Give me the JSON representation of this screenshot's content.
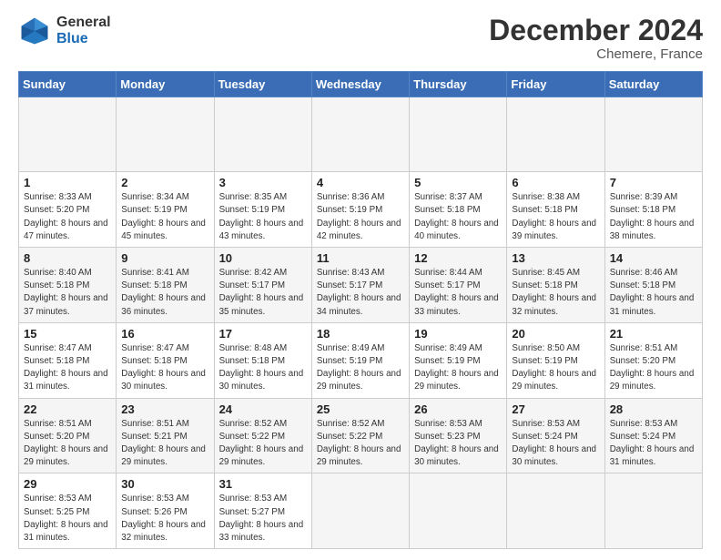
{
  "header": {
    "logo": {
      "general": "General",
      "blue": "Blue"
    },
    "month_title": "December 2024",
    "location": "Chemere, France"
  },
  "calendar": {
    "days_of_week": [
      "Sunday",
      "Monday",
      "Tuesday",
      "Wednesday",
      "Thursday",
      "Friday",
      "Saturday"
    ],
    "weeks": [
      [
        {
          "day": null,
          "info": null
        },
        {
          "day": null,
          "info": null
        },
        {
          "day": null,
          "info": null
        },
        {
          "day": null,
          "info": null
        },
        {
          "day": null,
          "info": null
        },
        {
          "day": null,
          "info": null
        },
        {
          "day": null,
          "info": null
        }
      ],
      [
        {
          "day": "1",
          "sunrise": "Sunrise: 8:33 AM",
          "sunset": "Sunset: 5:20 PM",
          "daylight": "Daylight: 8 hours and 47 minutes."
        },
        {
          "day": "2",
          "sunrise": "Sunrise: 8:34 AM",
          "sunset": "Sunset: 5:19 PM",
          "daylight": "Daylight: 8 hours and 45 minutes."
        },
        {
          "day": "3",
          "sunrise": "Sunrise: 8:35 AM",
          "sunset": "Sunset: 5:19 PM",
          "daylight": "Daylight: 8 hours and 43 minutes."
        },
        {
          "day": "4",
          "sunrise": "Sunrise: 8:36 AM",
          "sunset": "Sunset: 5:19 PM",
          "daylight": "Daylight: 8 hours and 42 minutes."
        },
        {
          "day": "5",
          "sunrise": "Sunrise: 8:37 AM",
          "sunset": "Sunset: 5:18 PM",
          "daylight": "Daylight: 8 hours and 40 minutes."
        },
        {
          "day": "6",
          "sunrise": "Sunrise: 8:38 AM",
          "sunset": "Sunset: 5:18 PM",
          "daylight": "Daylight: 8 hours and 39 minutes."
        },
        {
          "day": "7",
          "sunrise": "Sunrise: 8:39 AM",
          "sunset": "Sunset: 5:18 PM",
          "daylight": "Daylight: 8 hours and 38 minutes."
        }
      ],
      [
        {
          "day": "8",
          "sunrise": "Sunrise: 8:40 AM",
          "sunset": "Sunset: 5:18 PM",
          "daylight": "Daylight: 8 hours and 37 minutes."
        },
        {
          "day": "9",
          "sunrise": "Sunrise: 8:41 AM",
          "sunset": "Sunset: 5:18 PM",
          "daylight": "Daylight: 8 hours and 36 minutes."
        },
        {
          "day": "10",
          "sunrise": "Sunrise: 8:42 AM",
          "sunset": "Sunset: 5:17 PM",
          "daylight": "Daylight: 8 hours and 35 minutes."
        },
        {
          "day": "11",
          "sunrise": "Sunrise: 8:43 AM",
          "sunset": "Sunset: 5:17 PM",
          "daylight": "Daylight: 8 hours and 34 minutes."
        },
        {
          "day": "12",
          "sunrise": "Sunrise: 8:44 AM",
          "sunset": "Sunset: 5:17 PM",
          "daylight": "Daylight: 8 hours and 33 minutes."
        },
        {
          "day": "13",
          "sunrise": "Sunrise: 8:45 AM",
          "sunset": "Sunset: 5:18 PM",
          "daylight": "Daylight: 8 hours and 32 minutes."
        },
        {
          "day": "14",
          "sunrise": "Sunrise: 8:46 AM",
          "sunset": "Sunset: 5:18 PM",
          "daylight": "Daylight: 8 hours and 31 minutes."
        }
      ],
      [
        {
          "day": "15",
          "sunrise": "Sunrise: 8:47 AM",
          "sunset": "Sunset: 5:18 PM",
          "daylight": "Daylight: 8 hours and 31 minutes."
        },
        {
          "day": "16",
          "sunrise": "Sunrise: 8:47 AM",
          "sunset": "Sunset: 5:18 PM",
          "daylight": "Daylight: 8 hours and 30 minutes."
        },
        {
          "day": "17",
          "sunrise": "Sunrise: 8:48 AM",
          "sunset": "Sunset: 5:18 PM",
          "daylight": "Daylight: 8 hours and 30 minutes."
        },
        {
          "day": "18",
          "sunrise": "Sunrise: 8:49 AM",
          "sunset": "Sunset: 5:19 PM",
          "daylight": "Daylight: 8 hours and 29 minutes."
        },
        {
          "day": "19",
          "sunrise": "Sunrise: 8:49 AM",
          "sunset": "Sunset: 5:19 PM",
          "daylight": "Daylight: 8 hours and 29 minutes."
        },
        {
          "day": "20",
          "sunrise": "Sunrise: 8:50 AM",
          "sunset": "Sunset: 5:19 PM",
          "daylight": "Daylight: 8 hours and 29 minutes."
        },
        {
          "day": "21",
          "sunrise": "Sunrise: 8:51 AM",
          "sunset": "Sunset: 5:20 PM",
          "daylight": "Daylight: 8 hours and 29 minutes."
        }
      ],
      [
        {
          "day": "22",
          "sunrise": "Sunrise: 8:51 AM",
          "sunset": "Sunset: 5:20 PM",
          "daylight": "Daylight: 8 hours and 29 minutes."
        },
        {
          "day": "23",
          "sunrise": "Sunrise: 8:51 AM",
          "sunset": "Sunset: 5:21 PM",
          "daylight": "Daylight: 8 hours and 29 minutes."
        },
        {
          "day": "24",
          "sunrise": "Sunrise: 8:52 AM",
          "sunset": "Sunset: 5:22 PM",
          "daylight": "Daylight: 8 hours and 29 minutes."
        },
        {
          "day": "25",
          "sunrise": "Sunrise: 8:52 AM",
          "sunset": "Sunset: 5:22 PM",
          "daylight": "Daylight: 8 hours and 29 minutes."
        },
        {
          "day": "26",
          "sunrise": "Sunrise: 8:53 AM",
          "sunset": "Sunset: 5:23 PM",
          "daylight": "Daylight: 8 hours and 30 minutes."
        },
        {
          "day": "27",
          "sunrise": "Sunrise: 8:53 AM",
          "sunset": "Sunset: 5:24 PM",
          "daylight": "Daylight: 8 hours and 30 minutes."
        },
        {
          "day": "28",
          "sunrise": "Sunrise: 8:53 AM",
          "sunset": "Sunset: 5:24 PM",
          "daylight": "Daylight: 8 hours and 31 minutes."
        }
      ],
      [
        {
          "day": "29",
          "sunrise": "Sunrise: 8:53 AM",
          "sunset": "Sunset: 5:25 PM",
          "daylight": "Daylight: 8 hours and 31 minutes."
        },
        {
          "day": "30",
          "sunrise": "Sunrise: 8:53 AM",
          "sunset": "Sunset: 5:26 PM",
          "daylight": "Daylight: 8 hours and 32 minutes."
        },
        {
          "day": "31",
          "sunrise": "Sunrise: 8:53 AM",
          "sunset": "Sunset: 5:27 PM",
          "daylight": "Daylight: 8 hours and 33 minutes."
        },
        {
          "day": null,
          "info": null
        },
        {
          "day": null,
          "info": null
        },
        {
          "day": null,
          "info": null
        },
        {
          "day": null,
          "info": null
        }
      ]
    ]
  }
}
